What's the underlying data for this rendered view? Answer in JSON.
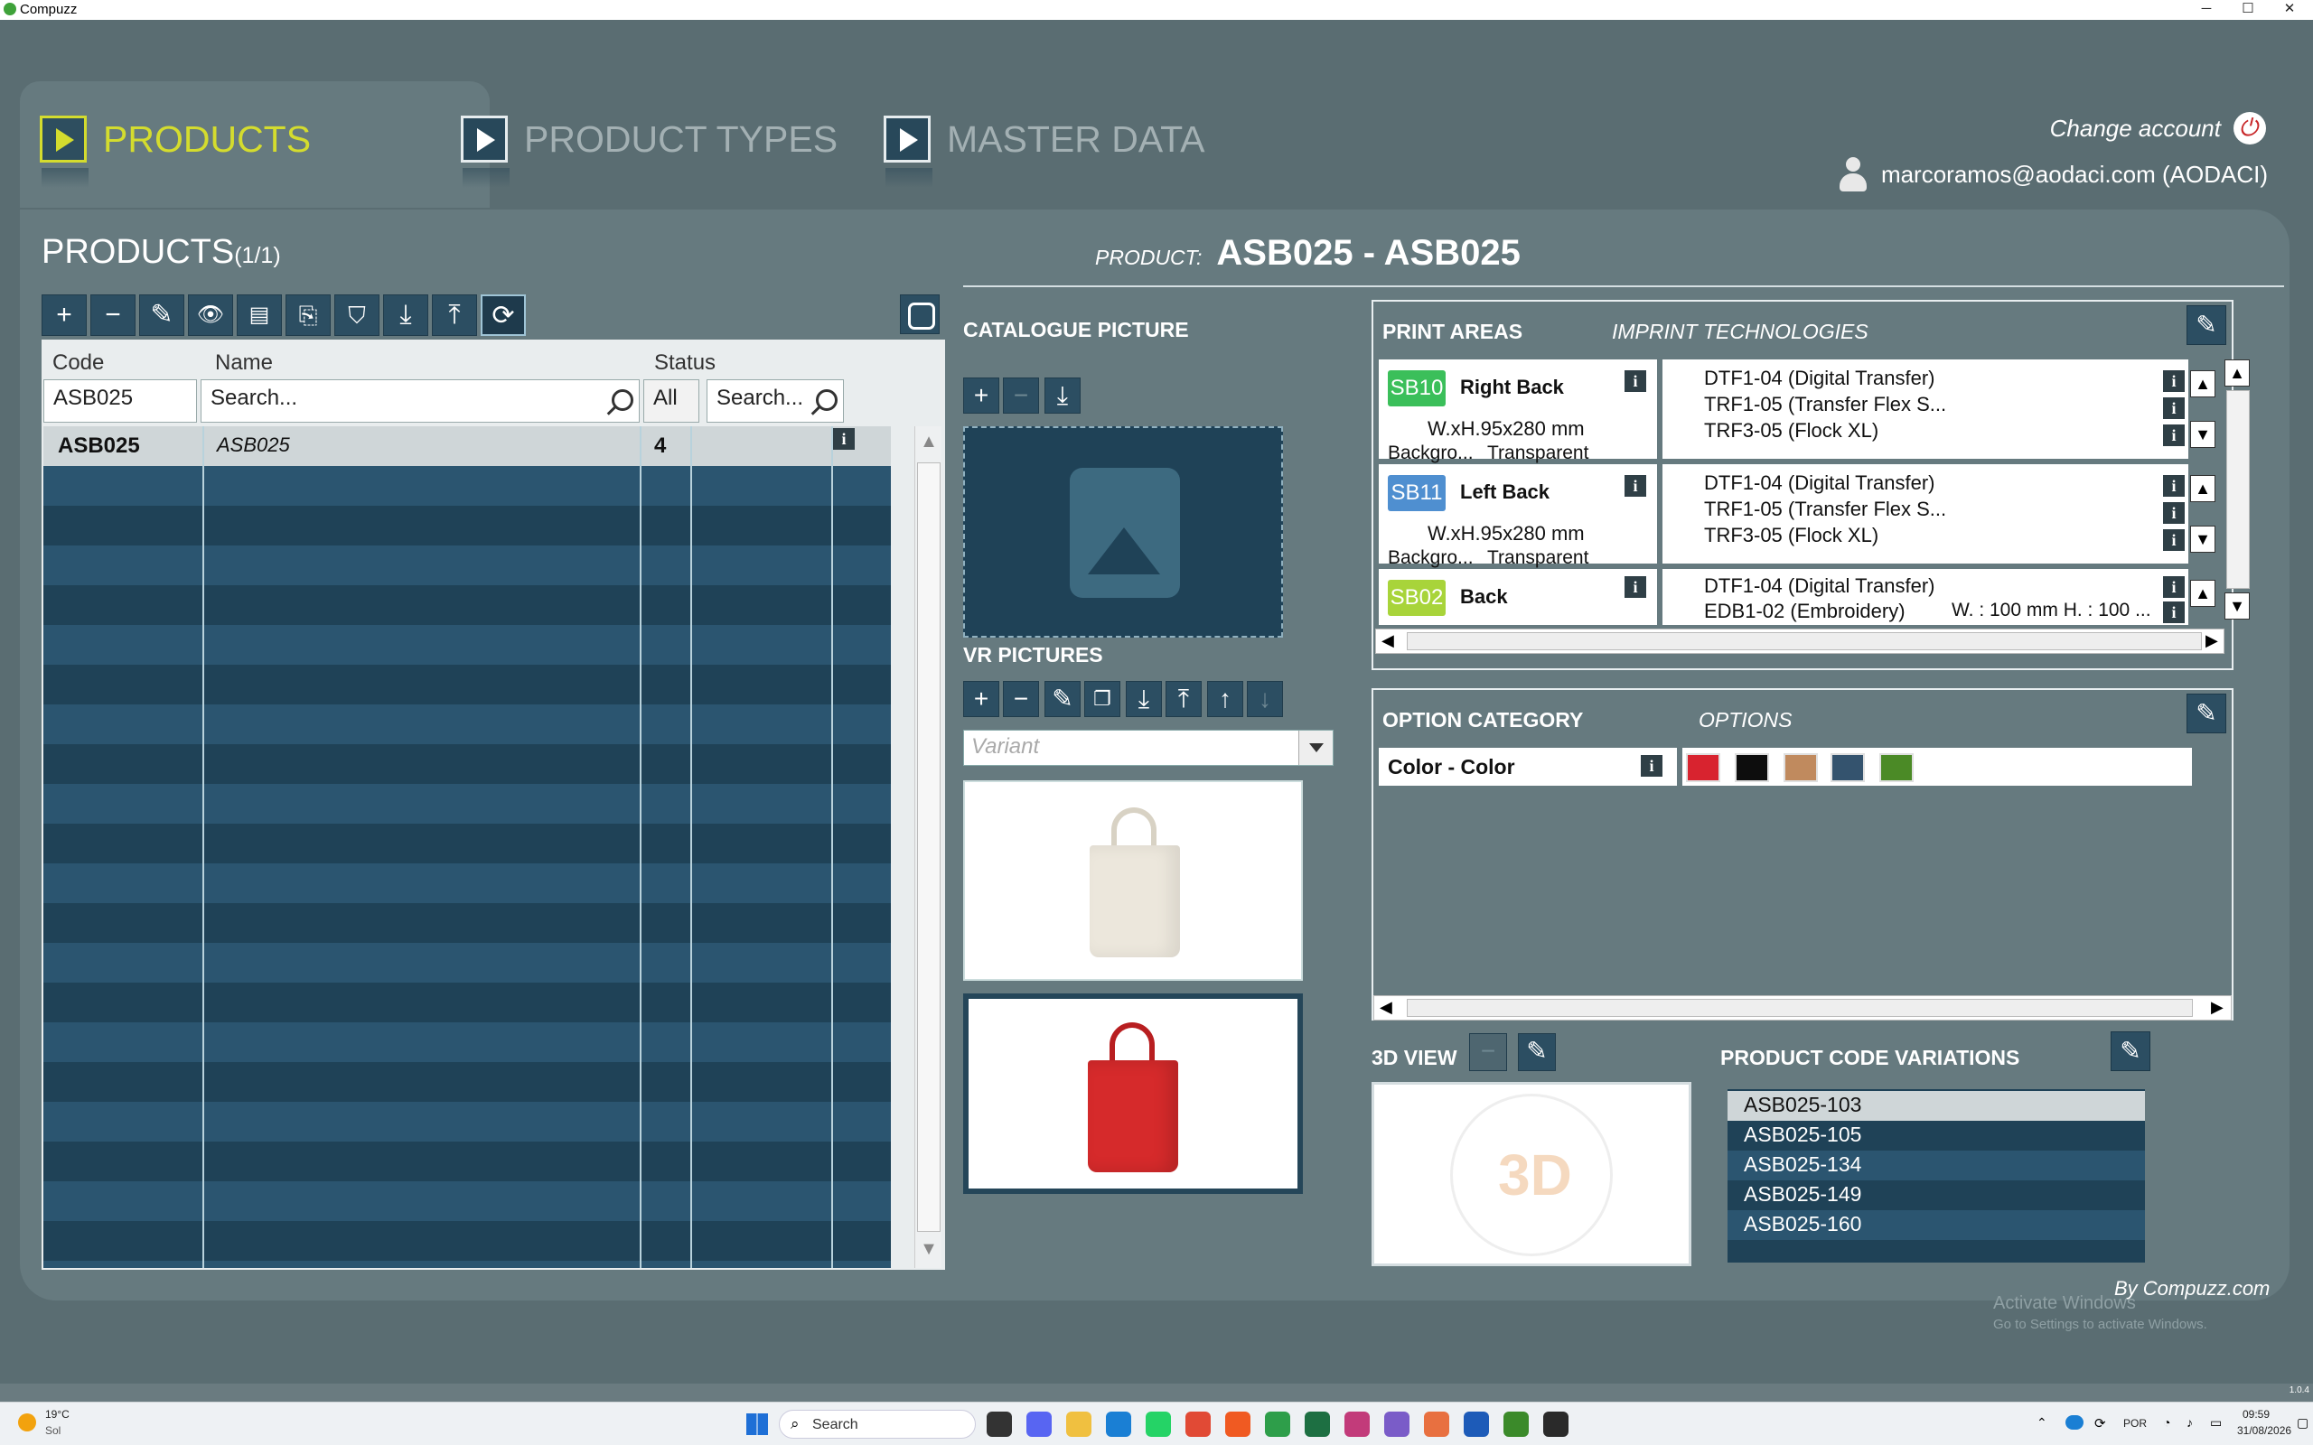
{
  "window": {
    "title": "Compuzz",
    "controls": [
      "─",
      "☐",
      "✕"
    ]
  },
  "tabs": [
    {
      "label": "PRODUCTS",
      "active": true
    },
    {
      "label": "PRODUCT TYPES",
      "active": false
    },
    {
      "label": "MASTER DATA",
      "active": false
    }
  ],
  "account": {
    "change_label": "Change account",
    "user": "marcoramos@aodaci.com (AODACI)"
  },
  "products": {
    "title": "PRODUCTS",
    "count": "(1/1)",
    "columns": {
      "code": "Code",
      "name": "Name",
      "status": "Status"
    },
    "filters": {
      "code_value": "ASB025",
      "name_placeholder": "Search...",
      "status_value": "All",
      "extra_placeholder": "Search..."
    },
    "rows": [
      {
        "code": "ASB025",
        "name": "ASB025",
        "status": "4"
      }
    ]
  },
  "product_header": {
    "label": "PRODUCT:",
    "value": "ASB025 - ASB025"
  },
  "catalogue": {
    "title": "CATALOGUE PICTURE"
  },
  "vr": {
    "title": "VR PICTURES",
    "variant_placeholder": "Variant"
  },
  "print_areas": {
    "title": "PRINT AREAS",
    "tech_title": "IMPRINT TECHNOLOGIES",
    "items": [
      {
        "code": "SB10",
        "color": "#3bbf5a",
        "name": "Right Back",
        "dims": "W.xH.95x280 mm",
        "bg_label": "Backgro...",
        "bg_value": "Transparent",
        "techs": [
          "DTF1-04 (Digital Transfer)",
          "TRF1-05 (Transfer Flex S...",
          "TRF3-05 (Flock XL)"
        ]
      },
      {
        "code": "SB11",
        "color": "#4f8fd0",
        "name": "Left Back",
        "dims": "W.xH.95x280 mm",
        "bg_label": "Backgro...",
        "bg_value": "Transparent",
        "techs": [
          "DTF1-04 (Digital Transfer)",
          "TRF1-05 (Transfer Flex S...",
          "TRF3-05 (Flock XL)"
        ]
      },
      {
        "code": "SB02",
        "color": "#a8d43a",
        "name": "Back",
        "dims": "",
        "bg_label": "",
        "bg_value": "",
        "techs": [
          "DTF1-04 (Digital Transfer)",
          "EDB1-02 (Embroidery)"
        ],
        "extra": "W. : 100 mm H. : 100 ..."
      }
    ]
  },
  "options": {
    "title": "OPTION CATEGORY",
    "options_title": "OPTIONS",
    "category": "Color - Color",
    "swatches": [
      "#d8232f",
      "#0d0d0d",
      "#c08a5e",
      "#34536e",
      "#4b8a26"
    ]
  },
  "view3d": {
    "title": "3D VIEW"
  },
  "code_variations": {
    "title": "PRODUCT CODE VARIATIONS",
    "items": [
      "ASB025-103",
      "ASB025-105",
      "ASB025-134",
      "ASB025-149",
      "ASB025-160"
    ]
  },
  "footer": {
    "by": "By Compuzz.com",
    "activate_title": "Activate Windows",
    "activate_sub": "Go to Settings to activate Windows."
  },
  "taskbar": {
    "weather_temp": "19°C",
    "weather_desc": "Sol",
    "search": "Search",
    "lang": "POR",
    "time": "09:59",
    "date": "31/08/2026",
    "version": "1.0.4"
  }
}
